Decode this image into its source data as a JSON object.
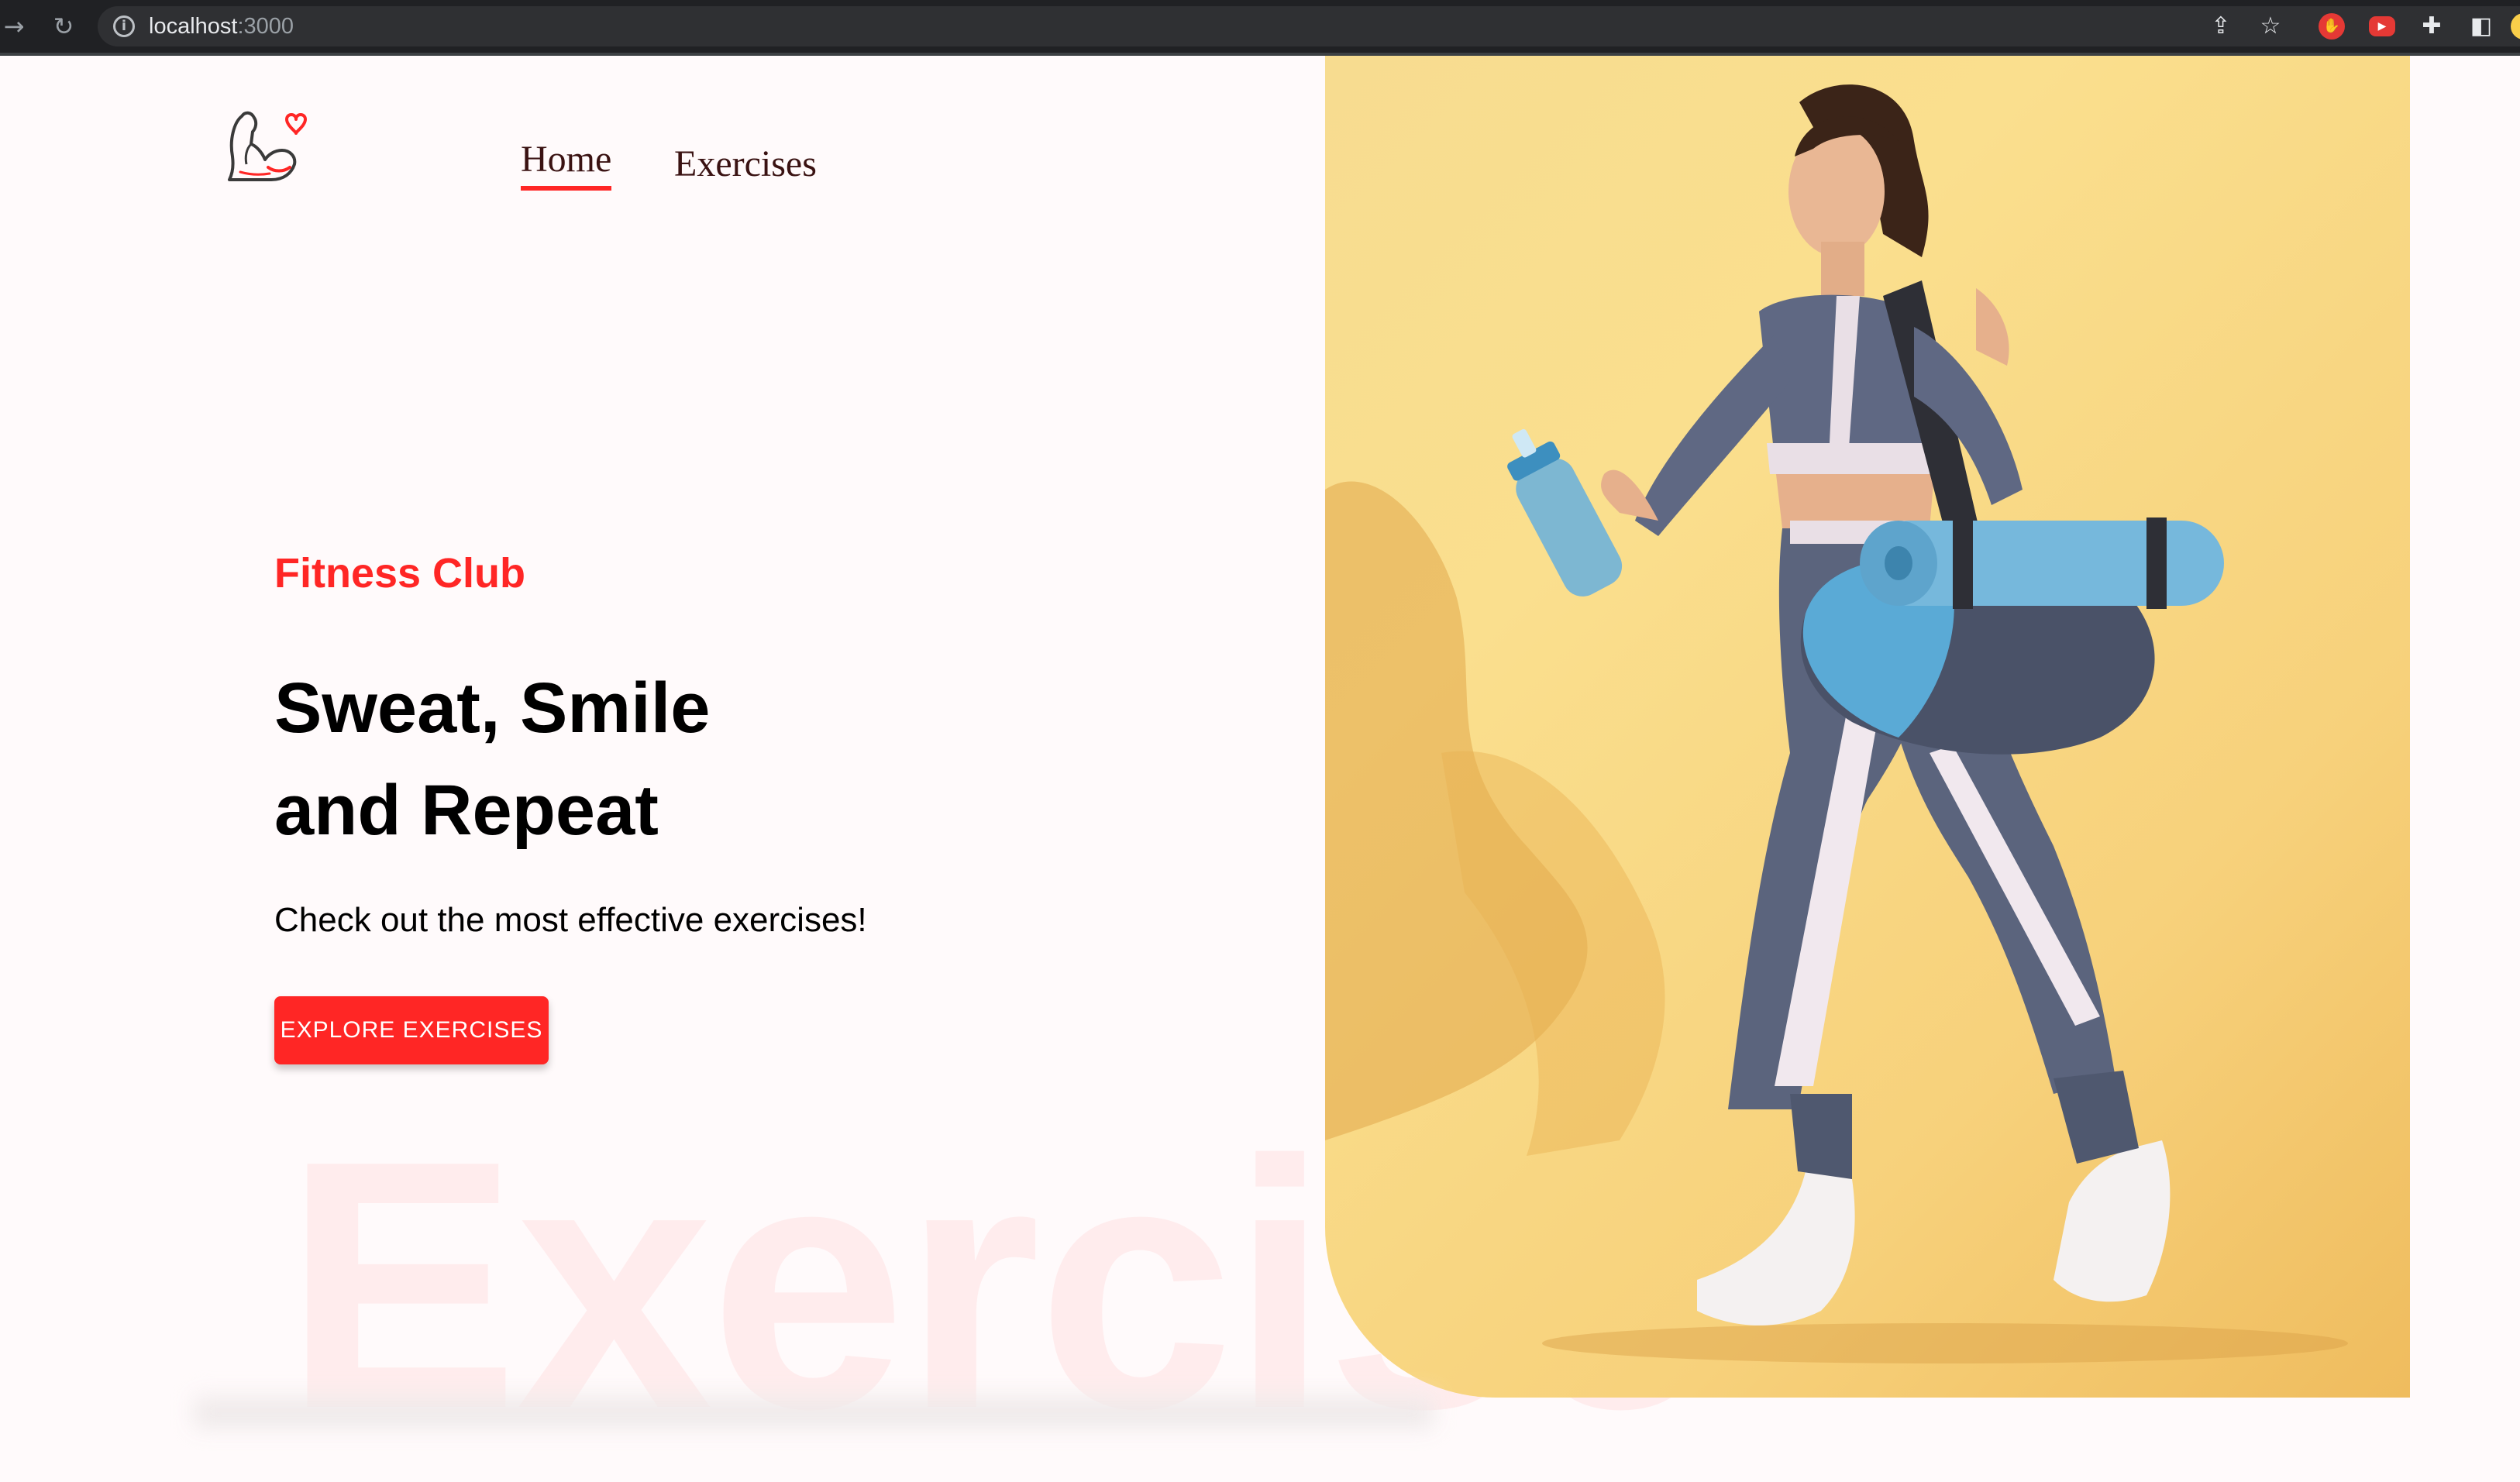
{
  "browser": {
    "url_host": "localhost",
    "url_port": ":3000",
    "icons": [
      "forward-icon",
      "reload-icon",
      "info-icon",
      "share-icon",
      "bookmark-star-icon",
      "extension-shield-icon",
      "extension-video-icon",
      "extensions-puzzle-icon",
      "side-panel-icon"
    ]
  },
  "nav": {
    "links": [
      {
        "label": "Home",
        "active": true
      },
      {
        "label": "Exercises",
        "active": false
      }
    ]
  },
  "hero": {
    "kicker": "Fitness Club",
    "headline_line1": "Sweat, Smile",
    "headline_line2": "and Repeat",
    "subtitle": "Check out the most effective exercises!",
    "cta_label": "EXPLORE EXERCISES",
    "watermark": "Exercise"
  },
  "colors": {
    "accent": "#ff2625",
    "page_bg": "#fffafb",
    "hero_bg": "#f7d781",
    "heading": "#000000"
  }
}
